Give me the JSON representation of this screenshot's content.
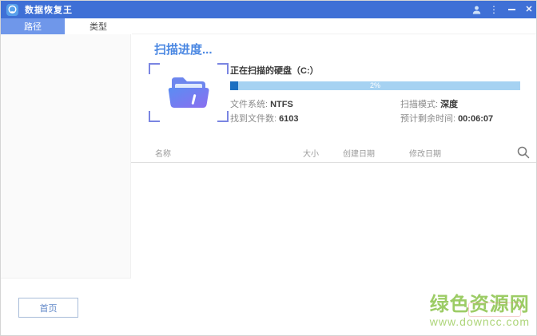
{
  "window": {
    "title": "数据恢复王"
  },
  "titlebar": {
    "icons": [
      "user-icon",
      "kebab-menu-icon",
      "minimize-icon",
      "close-icon"
    ]
  },
  "tabs": [
    {
      "label": "路径",
      "active": true
    },
    {
      "label": "类型",
      "active": false
    }
  ],
  "scan": {
    "heading": "扫描进度...",
    "target_label": "正在扫描的硬盘（C:）",
    "progress_percent": "2%",
    "progress_value": 2.75,
    "stats": {
      "file_system": {
        "label": "文件系统:",
        "value": "NTFS"
      },
      "files_found": {
        "label": "找到文件数:",
        "value": "6103"
      },
      "scan_mode": {
        "label": "扫描模式:",
        "value": "深度"
      },
      "time_remaining": {
        "label": "预计剩余时间:",
        "value": "00:06:07"
      }
    }
  },
  "table": {
    "columns": [
      "名称",
      "大小",
      "创建日期",
      "修改日期"
    ]
  },
  "footer": {
    "home_button": "首页"
  },
  "watermark": {
    "line1": "绿色资源网",
    "line2": "www.downcc.com"
  },
  "colors": {
    "titlebar": "#3f70d6",
    "tab_active": "#6f97ea",
    "heading": "#4a87e2",
    "progress_track": "#a6d2f2",
    "progress_fill": "#1b6fc1",
    "folder_gradient_start": "#5b8df2",
    "folder_gradient_end": "#8b6ef0",
    "watermark_green": "#8bc34a",
    "home_button_text": "#6188c8"
  }
}
